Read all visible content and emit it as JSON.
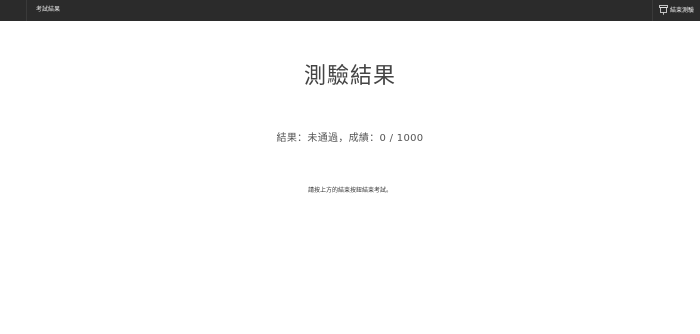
{
  "topbar": {
    "review_label": "考試結果",
    "exit_label": "結束測驗",
    "exit_icon": "exit-door-icon"
  },
  "main": {
    "title": "測驗結果",
    "result_line": "結果：未通過，成績：0 / 1000",
    "hint": "請按上方的結束按鈕結束考試。"
  },
  "colors": {
    "topbar_bg": "#2b2b2b",
    "page_bg": "#ffffff"
  }
}
